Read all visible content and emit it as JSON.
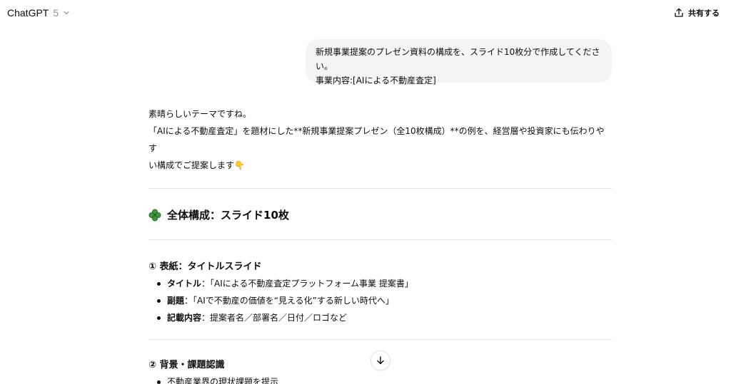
{
  "header": {
    "model_name": "ChatGPT",
    "model_version": "5",
    "share_label": "共有する"
  },
  "user_message": {
    "line1": "新規事業提案のプレゼン資料の構成を、スライド10枚分で作成してください。",
    "line2": "事業内容:[AIによる不動産査定]"
  },
  "assistant": {
    "intro_line1": "素晴らしいテーマですね。",
    "intro_line2": "「AIによる不動産査定」を題材にした**新規事業提案プレゼン（全10枚構成）**の例を、経営層や投資家にも伝わりやす",
    "intro_line3": "い構成でご提案します",
    "intro_emoji": "👇",
    "overview_heading": "全体構成：スライド10枚",
    "section1": {
      "heading": "① 表紙：タイトルスライド",
      "items": [
        {
          "label": "タイトル",
          "text": "：「AIによる不動産査定プラットフォーム事業 提案書」"
        },
        {
          "label": "副題",
          "text": "：「AIで不動産の価値を“見える化”する新しい時代へ」"
        },
        {
          "label": "記載内容",
          "text": "：提案者名／部署名／日付／ロゴなど"
        }
      ]
    },
    "section2": {
      "heading": "② 背景・課題認識",
      "items": [
        {
          "text": "不動産業界の現状課題を提示"
        }
      ]
    }
  },
  "colors": {
    "user_bubble_bg": "#f4f4f4",
    "divider": "#e5e5e5",
    "clover_green": "#3a9a3a"
  },
  "icons": {
    "model_dropdown": "chevron-down-icon",
    "share": "share-icon",
    "overview": "clover-icon",
    "scroll": "arrow-down-icon"
  }
}
